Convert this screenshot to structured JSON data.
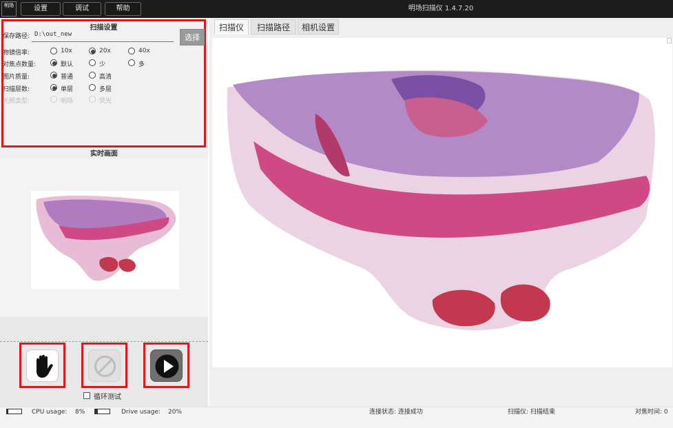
{
  "window": {
    "app_icon_text": "明场",
    "title": "明场扫描仪 1.4.7.20",
    "menu": [
      "设置",
      "调试",
      "帮助"
    ]
  },
  "scan_settings": {
    "title": "扫描设置",
    "save_path_label": "保存路径:",
    "save_path_value": "D:\\out_new",
    "choose_label": "选择",
    "objective_label": "物镜倍率:",
    "objective_options": [
      "10x",
      "20x",
      "40x"
    ],
    "objective_selected": "20x",
    "focus_points_label": "对焦点数量:",
    "focus_points_options": [
      "默认",
      "少",
      "多"
    ],
    "focus_points_selected": "默认",
    "image_quality_label": "图片质量:",
    "image_quality_options": [
      "普通",
      "高清"
    ],
    "image_quality_selected": "普通",
    "scan_layers_label": "扫描层数:",
    "scan_layers_options": [
      "单层",
      "多层"
    ],
    "scan_layers_selected": "单层",
    "illumination_label": "光照类型:",
    "illumination_options": [
      "明场",
      "荧光"
    ]
  },
  "live_view": {
    "title": "实时画面"
  },
  "controls": {
    "stop_icon": "hand-stop-icon",
    "cancel_icon": "prohibited-icon",
    "start_icon": "play-icon",
    "loop_test_label": "循环测试",
    "loop_test_checked": false
  },
  "tabs": [
    "扫描仪",
    "扫描路径",
    "相机设置"
  ],
  "active_tab": "扫描仪",
  "status": {
    "cpu_label": "CPU usage:",
    "cpu_value": "8%",
    "cpu_level": 0.08,
    "drive_label": "Drive usage:",
    "drive_value": "20%",
    "drive_level": 0.2,
    "connection": "连接状态: 连接成功",
    "scanner": "扫描仪: 扫描结束",
    "focus_time": "对焦时间: 0"
  },
  "colors": {
    "highlight_border": "#d71920",
    "tissue_light": "#d68fb8",
    "tissue_pink": "#c94d86",
    "tissue_purple": "#8a5aa8",
    "tissue_red": "#c2384f"
  }
}
